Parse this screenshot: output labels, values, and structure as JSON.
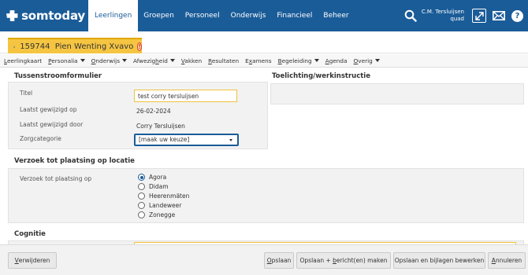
{
  "app": {
    "brand": "somtoday",
    "nav": [
      "Leerlingen",
      "Groepen",
      "Personeel",
      "Onderwijs",
      "Financieel",
      "Beheer"
    ],
    "active_nav": "Leerlingen",
    "user_name": "C.M. Tersluijsen",
    "user_role": "quad"
  },
  "student": {
    "label": "159744  Pien Wenting Xvavo",
    "warning": "!"
  },
  "submenu": [
    {
      "label": "Leerlingkaart",
      "u": "L",
      "rest": "eerlingkaart",
      "dropdown": false
    },
    {
      "label": "Personalia",
      "u": "P",
      "rest": "ersonalia",
      "dropdown": true
    },
    {
      "label": "Onderwijs",
      "u": "O",
      "rest": "nderwijs",
      "dropdown": true
    },
    {
      "label": "Afwezigheid",
      "pre": "Afwezig",
      "u": "h",
      "rest": "eid",
      "dropdown": true
    },
    {
      "label": "Vakken",
      "u": "V",
      "rest": "akken",
      "dropdown": false
    },
    {
      "label": "Resultaten",
      "u": "R",
      "rest": "esultaten",
      "dropdown": false
    },
    {
      "label": "Examens",
      "pre": "E",
      "u": "x",
      "rest": "amens",
      "dropdown": false
    },
    {
      "label": "Begeleiding",
      "u": "B",
      "rest": "egeleiding",
      "dropdown": true
    },
    {
      "label": "Agenda",
      "u": "A",
      "rest": "genda",
      "dropdown": false
    },
    {
      "label": "Overig",
      "u": "O",
      "rest": "verig",
      "dropdown": true
    }
  ],
  "form": {
    "section1_title": "Tussenstroomformulier",
    "titel_label": "Titel",
    "titel_value": "test corry tersluijsen",
    "gewijzigd_op_label": "Laatst gewijzigd op",
    "gewijzigd_op_value": "26-02-2024",
    "gewijzigd_door_label": "Laatst gewijzigd door",
    "gewijzigd_door_value": "Corry Tersluijsen",
    "zorg_label": "Zorgcategorie",
    "zorg_value": "[maak uw keuze]",
    "toelichting_title": "Toelichting/werkinstructie",
    "section2_title": "Verzoek tot plaatsing op locatie",
    "verzoek_label": "Verzoek tot plaatsing op",
    "locaties": [
      "Agora",
      "Didam",
      "Heerenmäten",
      "Landeweer",
      "Zonegge"
    ],
    "selected_locatie": "Agora",
    "section3_title": "Cognitie"
  },
  "footer": {
    "verwijderen": {
      "u": "V",
      "rest": "erwijderen"
    },
    "opslaan": {
      "u": "O",
      "rest": "pslaan"
    },
    "opslaan_berichten": {
      "pre": "Opslaan + ",
      "u": "b",
      "rest": "ericht(en) maken"
    },
    "opslaan_bijlagen": "Opslaan en bijlagen bewerken",
    "annuleren": {
      "u": "A",
      "rest": "nnuleren"
    }
  },
  "colors": {
    "brand_blue": "#1a5c98",
    "student_tab": "#f5c542",
    "panel_bg": "#f2f2f2"
  }
}
